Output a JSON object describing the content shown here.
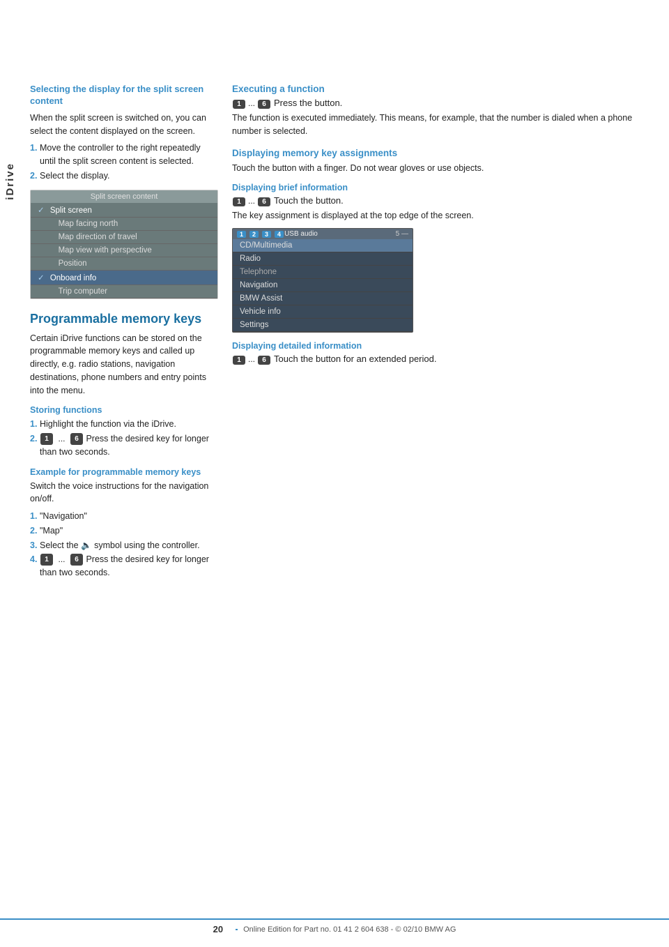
{
  "sidebar": {
    "label": "iDrive"
  },
  "left_column": {
    "section1": {
      "heading": "Selecting the display for the split screen content",
      "intro": "When the split screen is switched on, you can select the content displayed on the screen.",
      "steps": [
        "Move the controller to the right repeatedly until the split screen content is selected.",
        "Select the display."
      ],
      "split_screen_label": "Split screen content",
      "split_screen_items": [
        {
          "text": "Split screen",
          "checked": true
        },
        {
          "text": "Map facing north"
        },
        {
          "text": "Map direction of travel"
        },
        {
          "text": "Map view with perspective"
        },
        {
          "text": "Position"
        },
        {
          "text": "Onboard info",
          "highlighted": true,
          "checked": true
        },
        {
          "text": "Trip computer"
        }
      ]
    },
    "section2": {
      "heading": "Programmable memory keys",
      "intro": "Certain iDrive functions can be stored on the programmable memory keys and called up directly, e.g. radio stations, navigation destinations, phone numbers and entry points into the menu.",
      "storing_heading": "Storing functions",
      "storing_steps": [
        "Highlight the function via the iDrive.",
        "Press the desired key for longer than two seconds."
      ],
      "example_heading": "Example for programmable memory keys",
      "example_intro": "Switch the voice instructions for the navigation on/off.",
      "example_steps": [
        "\"Navigation\"",
        "\"Map\"",
        "Select the symbol using the controller.",
        "Press the desired key for longer than two seconds."
      ],
      "key1": "1",
      "key6": "6",
      "dots": "..."
    }
  },
  "right_column": {
    "executing_heading": "Executing a function",
    "executing_text": "Press the button.",
    "executing_detail": "The function is executed immediately. This means, for example, that the number is dialed when a phone number is selected.",
    "memory_heading": "Displaying memory key assignments",
    "memory_text": "Touch the button with a finger. Do not wear gloves or use objects.",
    "brief_heading": "Displaying brief information",
    "brief_text": "Touch the button.",
    "brief_detail": "The key assignment is displayed at the top edge of the screen.",
    "screen_topbar": {
      "seg1_num": "1",
      "seg2_num": "2",
      "seg3_num": "3",
      "seg4_num": "4",
      "seg4_text": "USB audio",
      "seg5_right": "5 —"
    },
    "screen_rows": [
      {
        "text": "CD/Multimedia",
        "highlight": true
      },
      {
        "text": "Radio"
      },
      {
        "text": "Telephone",
        "slight": true
      },
      {
        "text": "Navigation"
      },
      {
        "text": "BMW Assist"
      },
      {
        "text": "Vehicle info"
      },
      {
        "text": "Settings"
      }
    ],
    "detailed_heading": "Displaying detailed information",
    "detailed_text": "Touch the button for an extended period.",
    "key1": "1",
    "key6": "6",
    "dots": "..."
  },
  "footer": {
    "page_number": "20",
    "text": "Online Edition for Part no. 01 41 2 604 638 - © 02/10 BMW AG"
  }
}
